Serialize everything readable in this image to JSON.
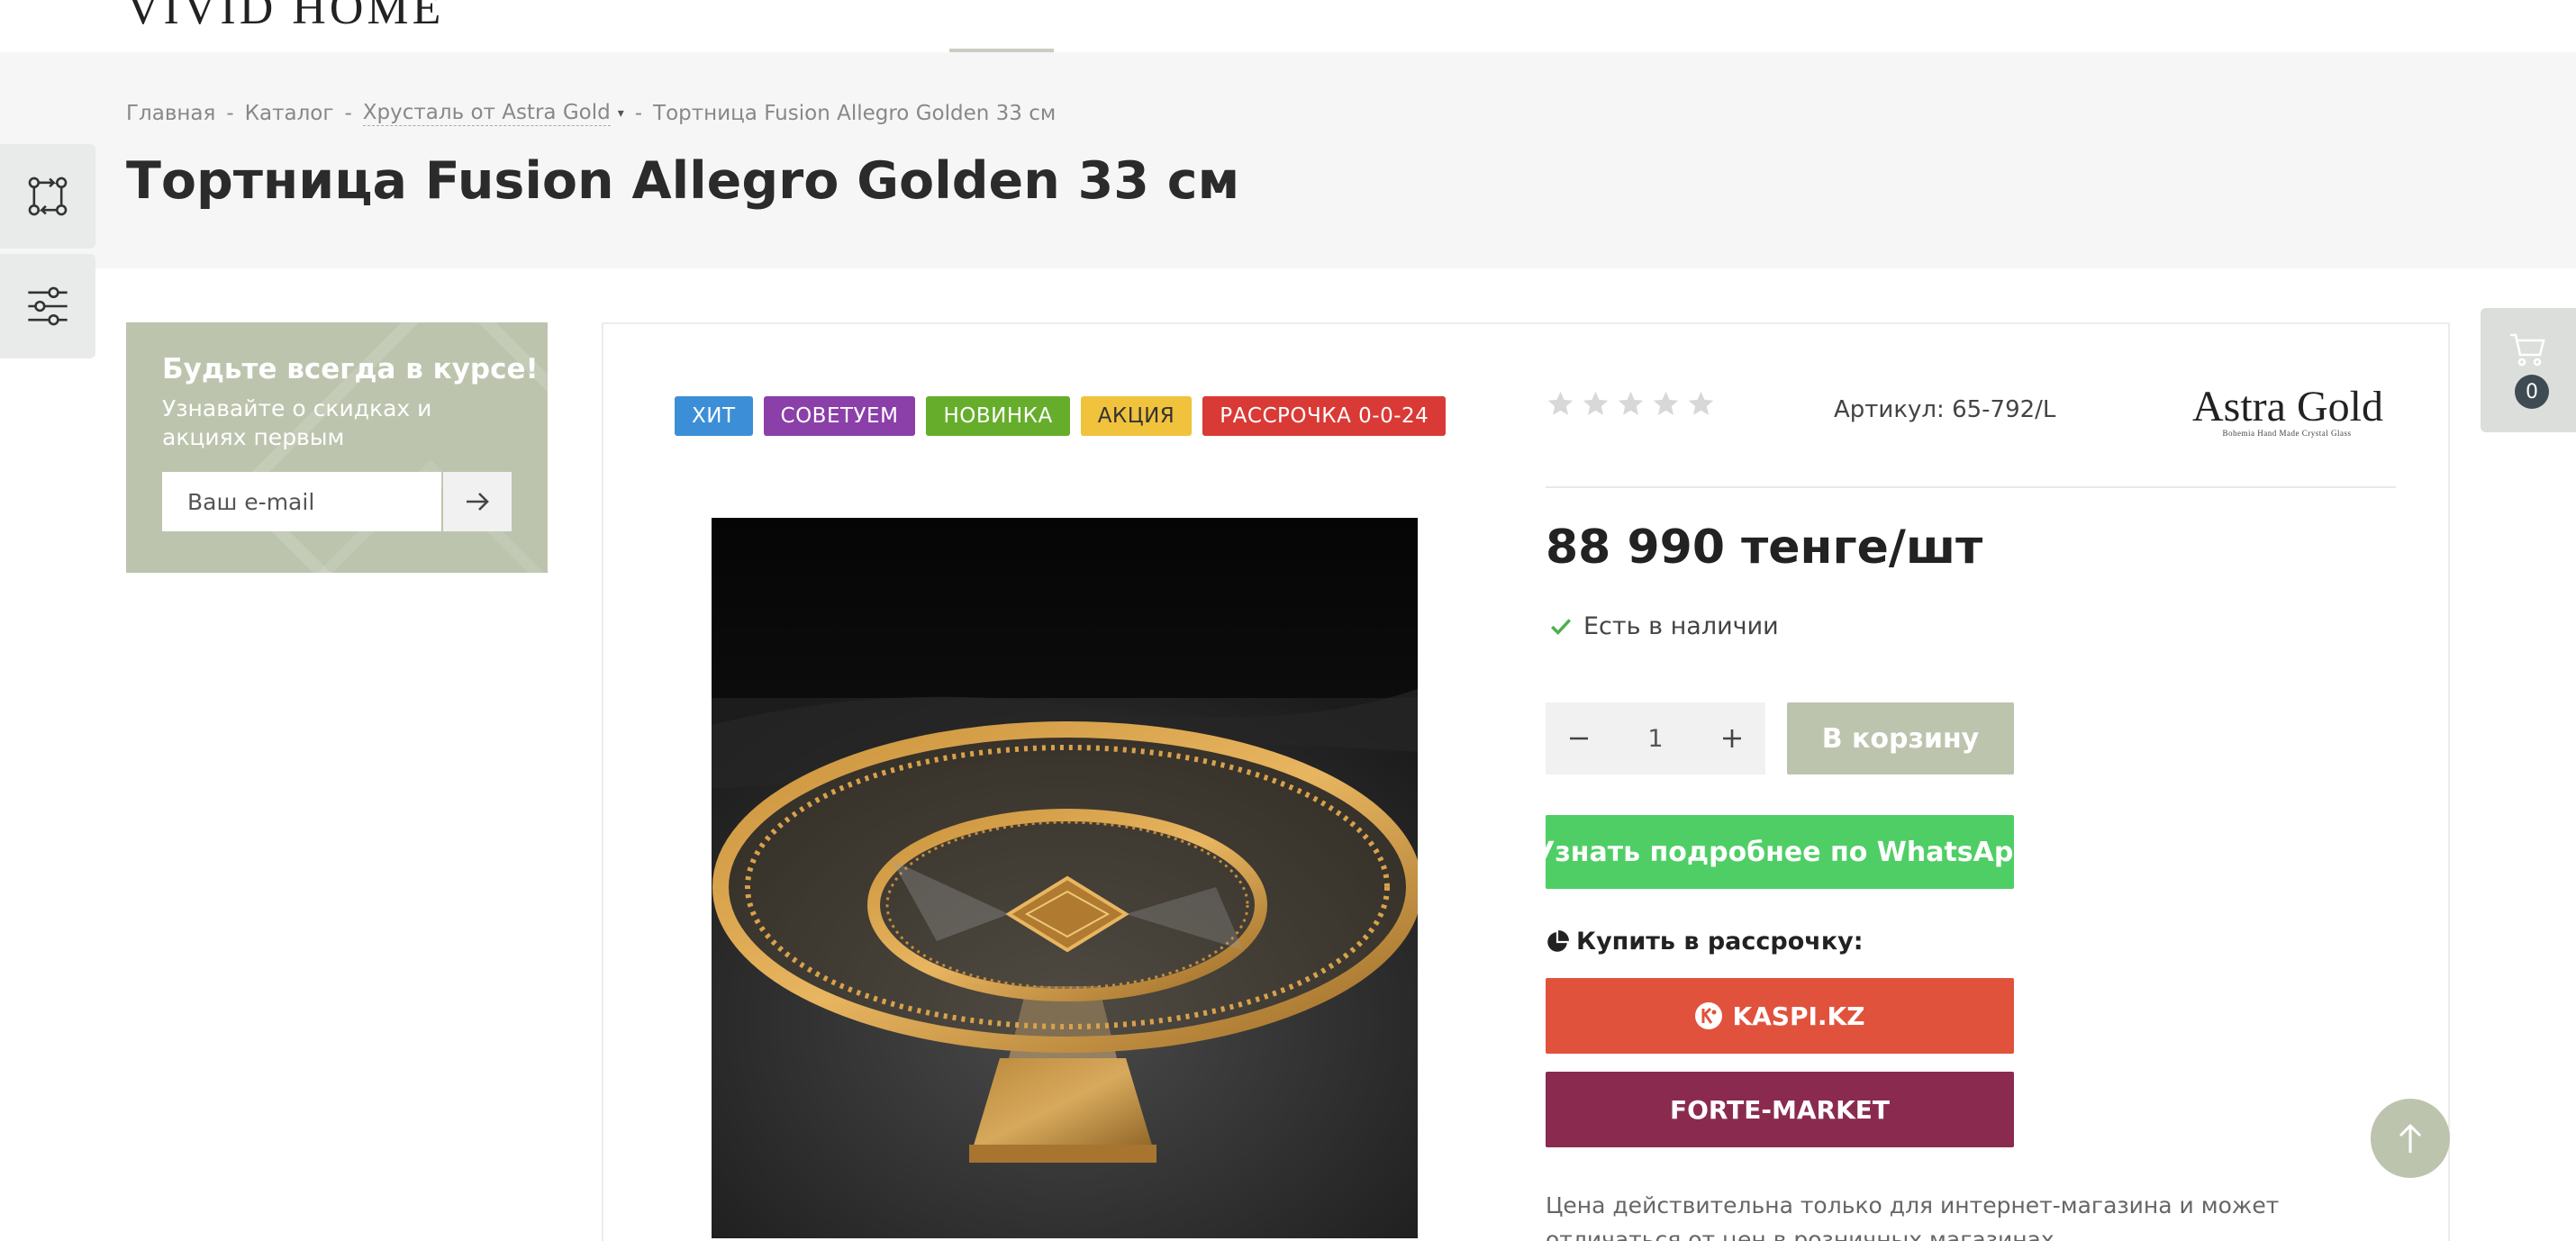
{
  "header": {
    "logo_text": "VIVID HOME"
  },
  "breadcrumb": {
    "items": [
      "Главная",
      "Каталог",
      "Хрусталь от Astra Gold",
      "Тортница Fusion Allegro Golden 33 см"
    ],
    "separator": "-"
  },
  "page": {
    "title": "Тортница Fusion Allegro Golden 33 см"
  },
  "side_tabs": {
    "compare_icon": "compare-icon",
    "filter_icon": "filter-sliders-icon"
  },
  "subscribe": {
    "title": "Будьте всегда в курсе!",
    "text": "Узнавайте о скидках и акциях первым",
    "placeholder": "Ваш e-mail",
    "submit_icon": "arrow-right-icon"
  },
  "product": {
    "badges": [
      {
        "label": "ХИТ",
        "color": "#3c8fd6"
      },
      {
        "label": "СОВЕТУЕМ",
        "color": "#8b3fa8"
      },
      {
        "label": "НОВИНКА",
        "color": "#66ad2c"
      },
      {
        "label": "АКЦИЯ",
        "color": "#f1c23c"
      },
      {
        "label": "РАССРОЧКА 0-0-24",
        "color": "#d93a36"
      }
    ],
    "rating": 0,
    "rating_max": 5,
    "sku": "Артикул: 65-792/L",
    "brand": {
      "name": "Astra Gold",
      "tagline": "Bohemia Hand Made   Crystal Glass"
    },
    "price": "88 990 тенге/шт",
    "stock": "Есть в наличии",
    "quantity": "1",
    "add_to_cart": "В корзину",
    "whatsapp": "Узнать подробнее по WhatsApp",
    "installment_label": "Купить в рассрочку:",
    "kaspi": "KASPI.KZ",
    "forte": "FORTE-MARKET",
    "note": "Цена действительна только для интернет-магазина и может отличаться от цен в розничных магазинах"
  },
  "cart_widget": {
    "count": "0"
  },
  "colors": {
    "accent": "#bcc4ad",
    "whatsapp": "#4fce66",
    "kaspi": "#e1523d",
    "forte": "#8b2a4f"
  }
}
